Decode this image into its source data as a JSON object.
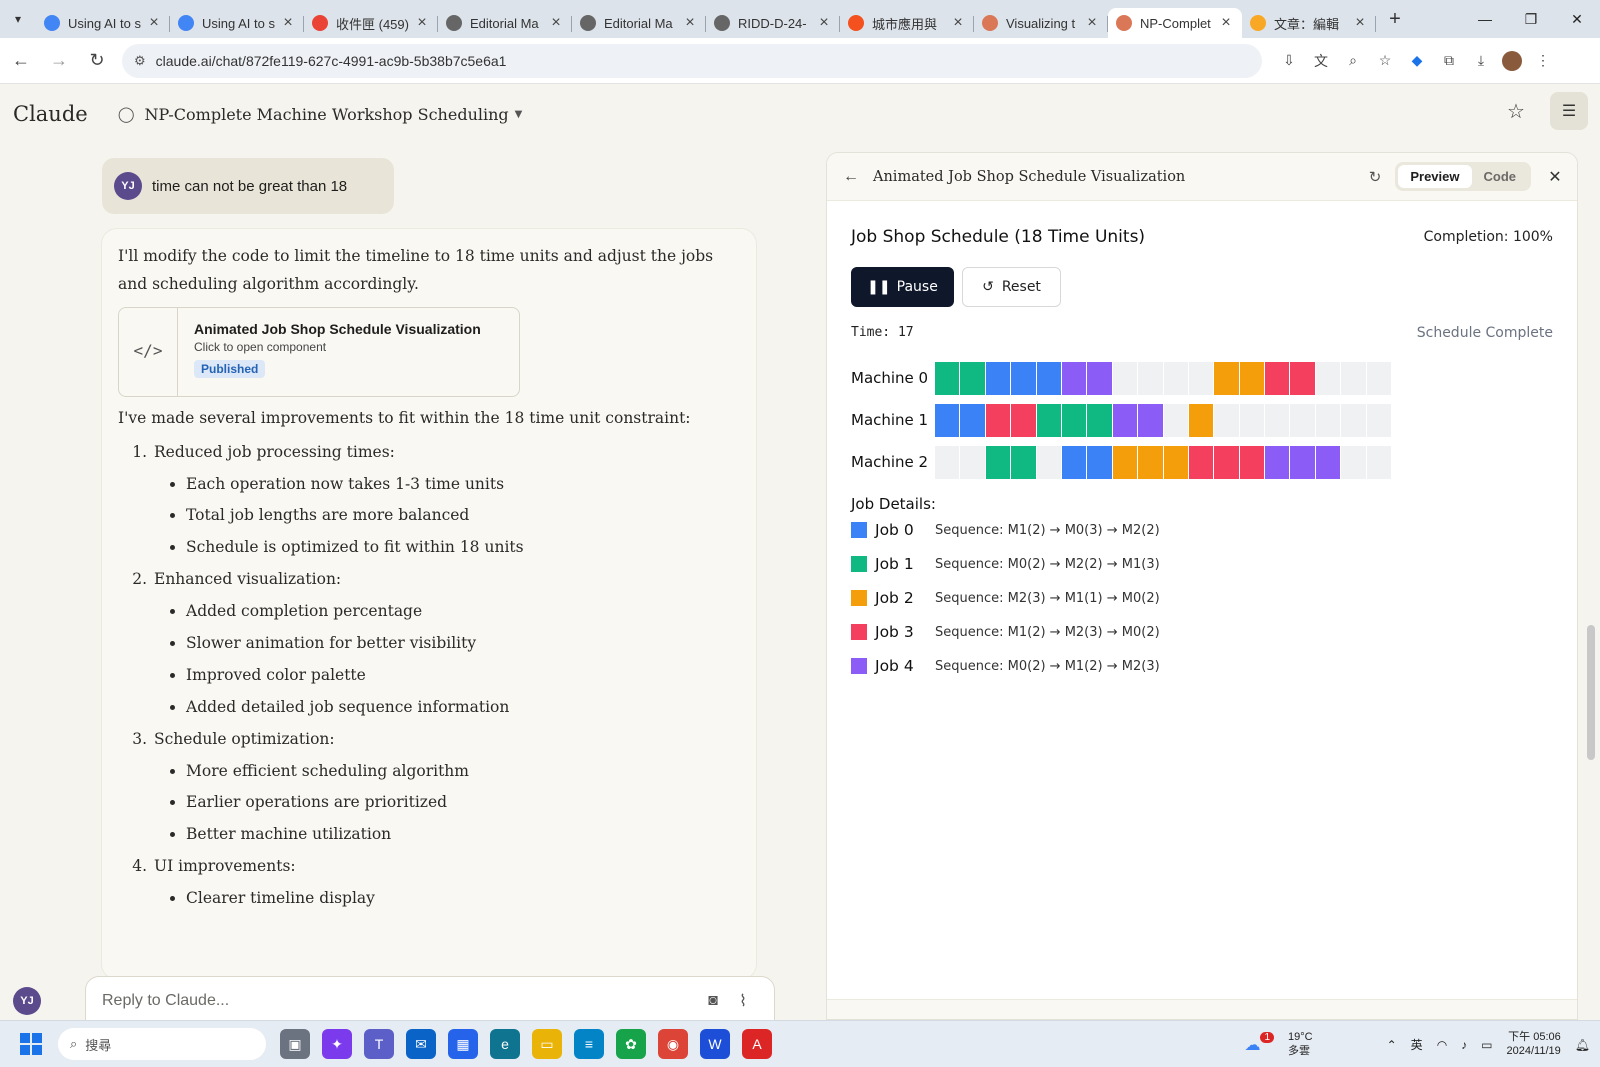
{
  "browser": {
    "tabs": [
      {
        "title": "Using AI to s",
        "fav_color": "#4285f4",
        "active": false
      },
      {
        "title": "Using AI to s",
        "fav_color": "#4285f4",
        "active": false
      },
      {
        "title": "收件匣 (459)",
        "fav_color": "#ea4335",
        "active": false
      },
      {
        "title": "Editorial Ma",
        "fav_color": "#666666",
        "active": false
      },
      {
        "title": "Editorial Ma",
        "fav_color": "#666666",
        "active": false
      },
      {
        "title": "RIDD-D-24-",
        "fav_color": "#666666",
        "active": false
      },
      {
        "title": "城市應用與",
        "fav_color": "#f4511e",
        "active": false
      },
      {
        "title": "Visualizing t",
        "fav_color": "#d97757",
        "active": false
      },
      {
        "title": "NP-Complet",
        "fav_color": "#d97757",
        "active": true
      },
      {
        "title": "文章：編輯",
        "fav_color": "#f9a825",
        "active": false
      }
    ],
    "url": "claude.ai/chat/872fe119-627c-4991-ac9b-5b38b7c5e6a1"
  },
  "app": {
    "logo": "Claude",
    "chat_title": "NP-Complete Machine Workshop Scheduling"
  },
  "conversation": {
    "user_initials": "YJ",
    "user_message": "time can not be great than 18",
    "assistant_intro": "I'll modify the code to limit the timeline to 18 time units and adjust the jobs and scheduling algorithm accordingly.",
    "artifact_card": {
      "name": "Animated Job Shop Schedule Visualization",
      "sub": "Click to open component",
      "badge": "Published"
    },
    "summary_line": "I've made several improvements to fit within the 18 time unit constraint:",
    "steps": [
      {
        "label": "Reduced job processing times:",
        "items": [
          "Each operation now takes 1-3 time units",
          "Total job lengths are more balanced",
          "Schedule is optimized to fit within 18 units"
        ]
      },
      {
        "label": "Enhanced visualization:",
        "items": [
          "Added completion percentage",
          "Slower animation for better visibility",
          "Improved color palette",
          "Added detailed job sequence information"
        ]
      },
      {
        "label": "Schedule optimization:",
        "items": [
          "More efficient scheduling algorithm",
          "Earlier operations are prioritized",
          "Better machine utilization"
        ]
      },
      {
        "label": "UI improvements:",
        "items": [
          "Clearer timeline display"
        ]
      }
    ],
    "reply_placeholder": "Reply to Claude..."
  },
  "panel": {
    "title": "Animated Job Shop Schedule Visualization",
    "tab_preview": "Preview",
    "tab_code": "Code",
    "viz_title": "Job Shop Schedule (18 Time Units)",
    "completion": "Completion: 100%",
    "pause_label": "Pause",
    "reset_label": "Reset",
    "time_label": "Time: 17",
    "status": "Schedule Complete",
    "job_details_title": "Job Details:",
    "empty_color": "#f0f1f3",
    "jobs": [
      {
        "name": "Job 0",
        "color": "#3b82f6",
        "sequence": "Sequence: M1(2) → M0(3) → M2(2)"
      },
      {
        "name": "Job 1",
        "color": "#10b981",
        "sequence": "Sequence: M0(2) → M2(2) → M1(3)"
      },
      {
        "name": "Job 2",
        "color": "#f59e0b",
        "sequence": "Sequence: M2(3) → M1(1) → M0(2)"
      },
      {
        "name": "Job 3",
        "color": "#f43f5e",
        "sequence": "Sequence: M1(2) → M2(3) → M0(2)"
      },
      {
        "name": "Job 4",
        "color": "#8b5cf6",
        "sequence": "Sequence: M0(2) → M1(2) → M2(3)"
      }
    ],
    "machines": [
      {
        "label": "Machine 0",
        "slots": [
          1,
          1,
          0,
          0,
          0,
          4,
          4,
          null,
          null,
          null,
          null,
          2,
          2,
          3,
          3,
          null,
          null,
          null
        ]
      },
      {
        "label": "Machine 1",
        "slots": [
          0,
          0,
          3,
          3,
          1,
          1,
          1,
          4,
          4,
          null,
          2,
          null,
          null,
          null,
          null,
          null,
          null,
          null
        ]
      },
      {
        "label": "Machine 2",
        "slots": [
          null,
          null,
          1,
          1,
          null,
          0,
          0,
          2,
          2,
          2,
          3,
          3,
          3,
          4,
          4,
          4,
          null,
          null
        ]
      }
    ]
  },
  "taskbar": {
    "search_placeholder": "搜尋",
    "weather_temp": "19°C",
    "weather_desc": "多雲",
    "weather_badge": "1",
    "ime": "英",
    "time": "下午 05:06",
    "date": "2024/11/19"
  }
}
